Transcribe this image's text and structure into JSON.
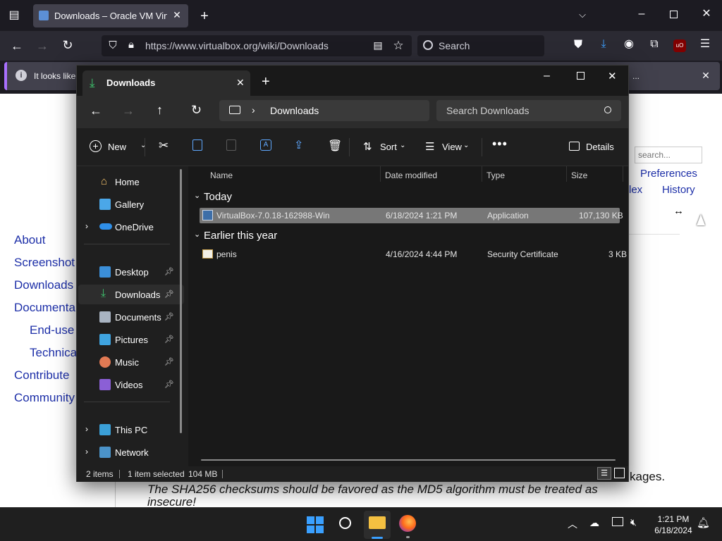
{
  "browser": {
    "tab_title": "Downloads – Oracle VM VirtualBox",
    "url": "https://www.virtualbox.org/wiki/Downloads",
    "search_placeholder": "Search",
    "notification_text": "It looks like",
    "notification_more": "..."
  },
  "webpage": {
    "sidebar_links": [
      "About",
      "Screenshot",
      "Downloads",
      "Documenta",
      "End-use",
      "Technica",
      "Contribute",
      "Community"
    ],
    "header_links": [
      "Preferences",
      "lex",
      "History"
    ],
    "search_placeholder": "search...",
    "text_fragment": "kages.",
    "italic_note": "The SHA256 checksums should be favored as the MD5 algorithm must be treated as insecure!"
  },
  "explorer": {
    "tab_title": "Downloads",
    "address": "Downloads",
    "search_placeholder": "Search Downloads",
    "commands": {
      "new": "New",
      "sort": "Sort",
      "view": "View",
      "details": "Details"
    },
    "nav": {
      "home": "Home",
      "gallery": "Gallery",
      "onedrive": "OneDrive",
      "desktop": "Desktop",
      "downloads": "Downloads",
      "documents": "Documents",
      "pictures": "Pictures",
      "music": "Music",
      "videos": "Videos",
      "this_pc": "This PC",
      "network": "Network"
    },
    "columns": {
      "name": "Name",
      "date": "Date modified",
      "type": "Type",
      "size": "Size"
    },
    "groups": [
      {
        "label": "Today",
        "files": [
          {
            "name": "VirtualBox-7.0.18-162988-Win",
            "date": "6/18/2024 1:21 PM",
            "type": "Application",
            "size": "107,130 KB",
            "selected": true
          }
        ]
      },
      {
        "label": "Earlier this year",
        "files": [
          {
            "name": "penis",
            "date": "4/16/2024 4:44 PM",
            "type": "Security Certificate",
            "size": "3 KB",
            "selected": false
          }
        ]
      }
    ],
    "status": {
      "items": "2 items",
      "selected": "1 item selected",
      "size": "104 MB"
    }
  },
  "taskbar": {
    "time": "1:21 PM",
    "date": "6/18/2024"
  }
}
